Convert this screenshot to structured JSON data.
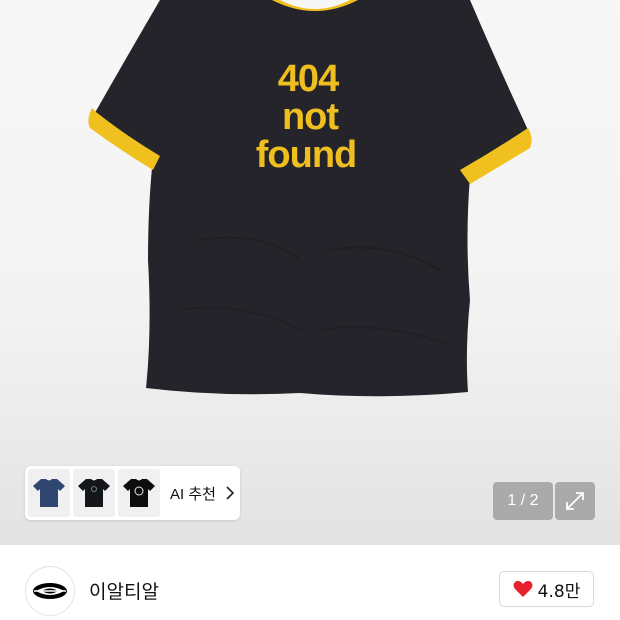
{
  "product": {
    "print_line1": "404",
    "print_line2": "not",
    "print_line3": "found",
    "shirt_color": "#24242a",
    "trim_color": "#f0c01e"
  },
  "recommendations": {
    "label": "AI 추천",
    "thumbnails": [
      "navy-tshirt",
      "black-tshirt",
      "black-graphic-tshirt"
    ]
  },
  "gallery": {
    "counter": "1 / 2"
  },
  "brand": {
    "name": "이알티알",
    "like_count": "4.8만",
    "heart_color": "#e8212e"
  }
}
